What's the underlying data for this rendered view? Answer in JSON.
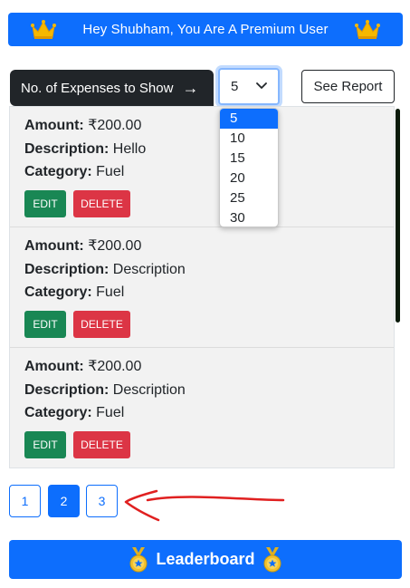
{
  "banner": {
    "text": "Hey Shubham, You Are A Premium User",
    "left_icon": "crown-icon",
    "right_icon": "crown-icon"
  },
  "controls": {
    "count_label": "No. of Expenses to Show",
    "count_arrow": "→",
    "select_value": "5",
    "report_label": "See Report"
  },
  "dropdown": {
    "options": [
      "5",
      "10",
      "15",
      "20",
      "25",
      "30"
    ],
    "selected": "5"
  },
  "expenses": [
    {
      "amount_label": "Amount:",
      "amount": "₹200.00",
      "description_label": "Description:",
      "description": "Hello",
      "category_label": "Category:",
      "category": "Fuel",
      "edit_label": "EDIT",
      "delete_label": "DELETE"
    },
    {
      "amount_label": "Amount:",
      "amount": "₹200.00",
      "description_label": "Description:",
      "description": "Description",
      "category_label": "Category:",
      "category": "Fuel",
      "edit_label": "EDIT",
      "delete_label": "DELETE"
    },
    {
      "amount_label": "Amount:",
      "amount": "₹200.00",
      "description_label": "Description:",
      "description": "Description",
      "category_label": "Category:",
      "category": "Fuel",
      "edit_label": "EDIT",
      "delete_label": "DELETE"
    }
  ],
  "pagination": {
    "pages": [
      "1",
      "2",
      "3"
    ],
    "current": "2"
  },
  "leaderboard": {
    "label": "Leaderboard",
    "icon": "medal-icon"
  },
  "colors": {
    "primary": "#0d6efd",
    "dark": "#212529",
    "success": "#198754",
    "danger": "#dc3545",
    "annotation": "#e02020"
  }
}
